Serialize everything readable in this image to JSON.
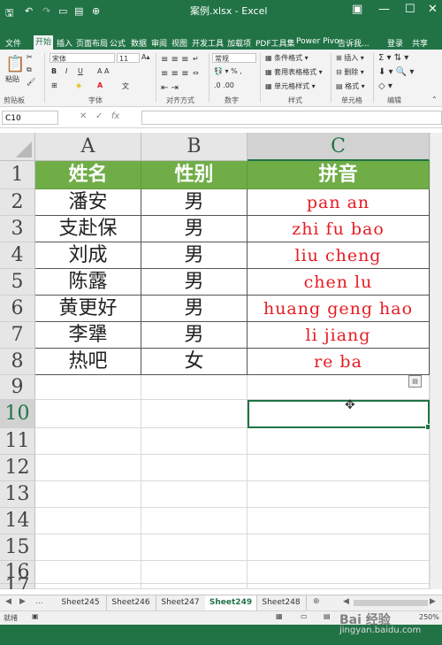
{
  "window": {
    "title": "案例.xlsx - Excel",
    "login": "登录",
    "share": "共享"
  },
  "menu": [
    "文件",
    "开始",
    "插入",
    "页面布局",
    "公式",
    "数据",
    "审阅",
    "视图",
    "开发工具",
    "加载项",
    "PDF工具集",
    "Power Pivo",
    "告诉我..."
  ],
  "ribbon": {
    "paste": "粘贴",
    "font_name": "宋体",
    "font_size": "11",
    "number_format": "常规",
    "cond_format": "条件格式",
    "table_format": "套用表格格式",
    "cell_style": "单元格样式",
    "insert": "插入",
    "delete": "删除",
    "format": "格式",
    "groups": [
      "剪贴板",
      "字体",
      "对齐方式",
      "数字",
      "样式",
      "单元格",
      "编辑"
    ]
  },
  "namebox": "C10",
  "columns": [
    "A",
    "B",
    "C"
  ],
  "rows": [
    "1",
    "2",
    "3",
    "4",
    "5",
    "6",
    "7",
    "8",
    "9",
    "10",
    "11",
    "12",
    "13",
    "14",
    "15",
    "16",
    "17"
  ],
  "table": {
    "headers": [
      "姓名",
      "性别",
      "拼音"
    ],
    "rows": [
      [
        "潘安",
        "男",
        "pan an"
      ],
      [
        "支赴保",
        "男",
        "zhi fu bao"
      ],
      [
        "刘成",
        "男",
        "liu cheng"
      ],
      [
        "陈露",
        "男",
        "chen lu"
      ],
      [
        "黄更好",
        "男",
        "huang geng hao"
      ],
      [
        "李犟",
        "男",
        "li jiang"
      ],
      [
        "热吧",
        "女",
        "re ba"
      ]
    ]
  },
  "sheets": [
    "Sheet245",
    "Sheet246",
    "Sheet247",
    "Sheet249",
    "Sheet248"
  ],
  "active_sheet": "Sheet249",
  "status": {
    "left": "就绪",
    "zoom": "250%"
  },
  "watermark": {
    "brand": "Bai 经验",
    "url": "jingyan.baidu.com"
  },
  "colors": {
    "excel_green": "#217346",
    "header_fill": "#70ad47",
    "pinyin_red": "#e51c23"
  }
}
